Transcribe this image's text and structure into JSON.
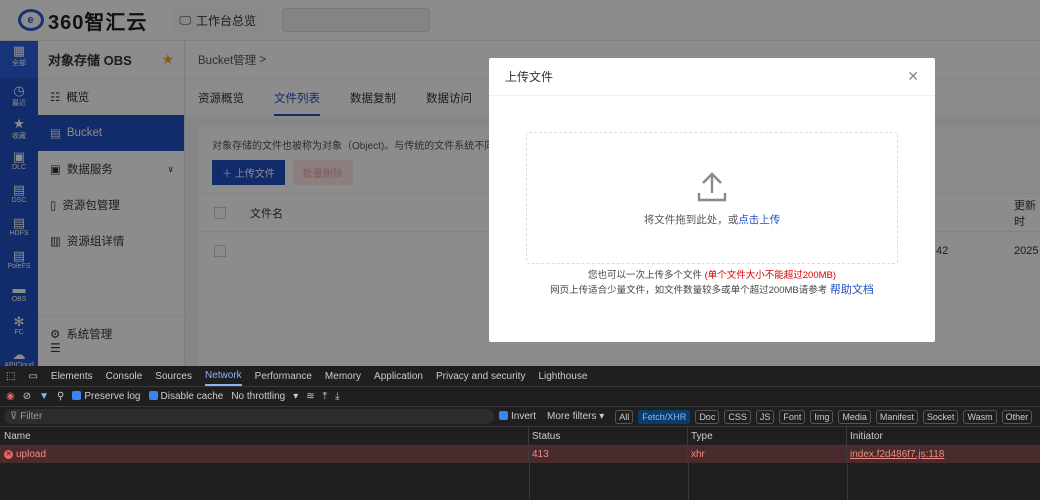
{
  "header": {
    "logo": "360智汇云",
    "workspace": "工作台总览"
  },
  "rail": [
    {
      "icon": "grid-icon",
      "label": "全部"
    },
    {
      "icon": "clock-icon",
      "label": "最近"
    },
    {
      "icon": "star-icon",
      "label": "收藏"
    },
    {
      "icon": "dlc-icon",
      "label": "DLC"
    },
    {
      "icon": "dsc-icon",
      "label": "DSC"
    },
    {
      "icon": "hdfs-icon",
      "label": "HDFS"
    },
    {
      "icon": "polefs-icon",
      "label": "PoleFS"
    },
    {
      "icon": "obs-icon",
      "label": "OBS"
    },
    {
      "icon": "fc-icon",
      "label": "FC"
    },
    {
      "icon": "cloud-icon",
      "label": "APICloud"
    }
  ],
  "sidebar": {
    "title": "对象存储 OBS",
    "items": [
      {
        "label": "概览"
      },
      {
        "label": "Bucket"
      },
      {
        "label": "数据服务"
      },
      {
        "label": "资源包管理"
      },
      {
        "label": "资源组详情"
      }
    ],
    "system": "系统管理"
  },
  "main": {
    "breadcrumb": "Bucket管理",
    "breadcrumb_sep": ">",
    "tabs": [
      "资源概览",
      "文件列表",
      "数据复制",
      "数据访问"
    ],
    "description": "对象存储的文件也被称为对象（Object)。与传统的文件系统不同",
    "upload_button": "上传文件",
    "batch_delete": "批量删除",
    "col_filename": "文件名",
    "col_updated": "更新时",
    "row_time_partial": ":42",
    "row_date_partial": "2025"
  },
  "modal": {
    "title": "上传文件",
    "drop_text": "将文件拖到此处，或",
    "drop_link": "点击上传",
    "note1": "您也可以一次上传多个文件",
    "note1_red": "(单个文件大小不能超过200MB)",
    "note2": "网页上传适合少量文件，如文件数量较多或单个超过200MB请参考",
    "help_link": "帮助文档"
  },
  "devtools": {
    "tabs": [
      "Elements",
      "Console",
      "Sources",
      "Network",
      "Performance",
      "Memory",
      "Application",
      "Privacy and security",
      "Lighthouse"
    ],
    "active_tab": "Network",
    "preserve_log": "Preserve log",
    "disable_cache": "Disable cache",
    "throttling": "No throttling",
    "filter_placeholder": "Filter",
    "invert": "Invert",
    "more_filters": "More filters",
    "chips": [
      "All",
      "Fetch/XHR",
      "Doc",
      "CSS",
      "JS",
      "Font",
      "Img",
      "Media",
      "Manifest",
      "Socket",
      "Wasm",
      "Other"
    ],
    "active_chip": "Fetch/XHR",
    "columns": [
      "Name",
      "Status",
      "Type",
      "Initiator"
    ],
    "rows": [
      {
        "name": "upload",
        "status": "413",
        "type": "xhr",
        "initiator": "index.f2d486f7.js:118"
      }
    ]
  },
  "colors": {
    "brand": "#1f4fc4",
    "error": "#f28b82",
    "limit_text": "#d40000"
  }
}
